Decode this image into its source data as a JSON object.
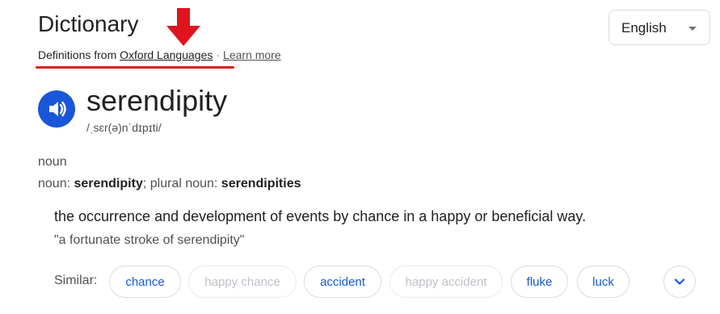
{
  "header": {
    "title": "Dictionary",
    "source_prefix": "Definitions from",
    "source_link": "Oxford Languages",
    "separator": "·",
    "learn_more": "Learn more"
  },
  "language_select": {
    "value": "English"
  },
  "entry": {
    "word": "serendipity",
    "phonetic": "/ˌsɛr(ə)nˈdɪpɪti/",
    "part_of_speech": "noun",
    "forms": {
      "label1": "noun: ",
      "form1": "serendipity",
      "label2": "; plural noun: ",
      "form2": "serendipities"
    },
    "definition": "the occurrence and development of events by chance in a happy or beneficial way.",
    "example": "\"a fortunate stroke of serendipity\""
  },
  "similar": {
    "label": "Similar:",
    "chips": [
      {
        "label": "chance",
        "active": true
      },
      {
        "label": "happy chance",
        "active": false
      },
      {
        "label": "accident",
        "active": true
      },
      {
        "label": "happy accident",
        "active": false
      },
      {
        "label": "fluke",
        "active": true
      },
      {
        "label": "luck",
        "active": true
      }
    ]
  },
  "icons": {
    "speaker": "speaker-icon",
    "expand": "chevron-down-icon",
    "annotation_arrow": "red-arrow-down-icon"
  },
  "colors": {
    "accent_blue": "#1a56d8",
    "annotation_red": "#e0141e",
    "link_blue": "#1558d6"
  }
}
